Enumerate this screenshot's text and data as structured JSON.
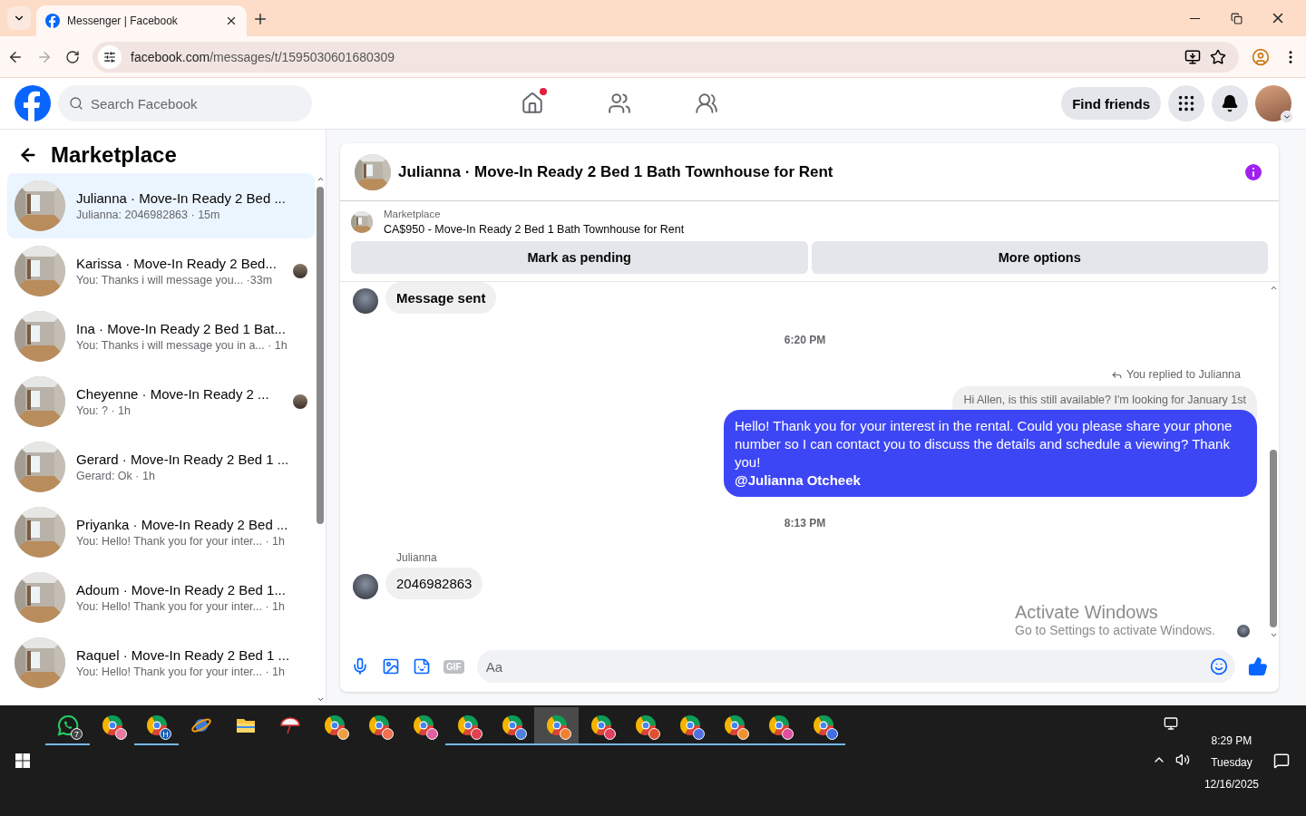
{
  "browser": {
    "tabs": [
      {
        "title": "Messenger | Facebook",
        "selected": true
      }
    ],
    "url_domain": "facebook.com",
    "url_path": "/messages/t/1595030601680309"
  },
  "header": {
    "search_placeholder": "Search Facebook",
    "home_notification": true,
    "find_friends": "Find friends"
  },
  "sidebar": {
    "title": "Marketplace",
    "conversations": [
      {
        "title": "Julianna · Move-In Ready 2 Bed ...",
        "preview": "Julianna: 2046982863 · 15m",
        "selected": true,
        "seen": false
      },
      {
        "title": "Karissa · Move-In Ready 2 Bed...",
        "preview": "You: Thanks i will message you... ·33m",
        "selected": false,
        "seen": true
      },
      {
        "title": "Ina · Move-In Ready 2 Bed 1 Bat...",
        "preview": "You: Thanks i will message you in a... · 1h",
        "selected": false,
        "seen": false
      },
      {
        "title": "Cheyenne · Move-In Ready 2 ...",
        "preview": "You: ? · 1h",
        "selected": false,
        "seen": true
      },
      {
        "title": "Gerard · Move-In Ready 2 Bed 1 ...",
        "preview": "Gerard: Ok · 1h",
        "selected": false,
        "seen": false
      },
      {
        "title": "Priyanka · Move-In Ready 2 Bed ...",
        "preview": "You: Hello! Thank you for your inter... · 1h",
        "selected": false,
        "seen": false
      },
      {
        "title": "Adoum · Move-In Ready 2 Bed 1...",
        "preview": "You: Hello! Thank you for your inter... · 1h",
        "selected": false,
        "seen": false
      },
      {
        "title": "Raquel · Move-In Ready 2 Bed 1 ...",
        "preview": "You: Hello! Thank you for your inter... · 1h",
        "selected": false,
        "seen": false
      }
    ]
  },
  "chat": {
    "title": "Julianna · Move-In Ready 2 Bed 1 Bath Townhouse for Rent",
    "listing_label": "Marketplace",
    "listing": "CA$950 - Move-In Ready 2 Bed 1 Bath Townhouse for Rent",
    "actions": [
      "Mark as pending",
      "More options"
    ],
    "messages": [
      {
        "kind": "incoming",
        "text": "Message sent",
        "bold": true
      },
      {
        "kind": "time",
        "text": "6:20 PM"
      },
      {
        "kind": "reply_note",
        "text": "You replied to Julianna"
      },
      {
        "kind": "quoted",
        "text": "Hi Allen, is this still available? I'm looking for January 1st"
      },
      {
        "kind": "outgoing",
        "text": "Hello! Thank you for your interest in the rental. Could you please share your phone number so I can contact you to discuss the details and schedule a viewing? Thank you!",
        "mention": "@Julianna Otcheek"
      },
      {
        "kind": "time",
        "text": "8:13 PM"
      },
      {
        "kind": "incoming",
        "sender": "Julianna",
        "text": "2046982863",
        "bold": false
      }
    ],
    "composer_placeholder": "Aa",
    "gif_label": "GIF"
  },
  "os_notice": {
    "title": "Activate Windows",
    "subtitle": "Go to Settings to activate Windows."
  },
  "taskbar": {
    "apps": [
      {
        "kind": "chat",
        "badge": "7",
        "open": true,
        "selected": false
      },
      {
        "kind": "browser",
        "color": "#e87aa0",
        "open": false,
        "selected": false
      },
      {
        "kind": "browser",
        "badge": "H",
        "color": "#1a5fb4",
        "open": true,
        "selected": false
      },
      {
        "kind": "orbit",
        "open": false,
        "selected": false
      },
      {
        "kind": "folder",
        "open": false,
        "selected": false
      },
      {
        "kind": "umbrella",
        "open": false,
        "selected": false
      },
      {
        "kind": "browser",
        "color": "#f0a040",
        "open": false,
        "selected": false
      },
      {
        "kind": "browser",
        "color": "#f07050",
        "open": false,
        "selected": false
      },
      {
        "kind": "browser",
        "color": "#e060a0",
        "open": false,
        "selected": false
      },
      {
        "kind": "browser",
        "color": "#e04050",
        "open": true,
        "selected": false
      },
      {
        "kind": "browser",
        "color": "#5080e0",
        "open": true,
        "selected": false
      },
      {
        "kind": "browser",
        "color": "#f08030",
        "open": true,
        "selected": true
      },
      {
        "kind": "browser",
        "color": "#e04060",
        "open": true,
        "selected": false
      },
      {
        "kind": "browser",
        "color": "#e05030",
        "open": true,
        "selected": false
      },
      {
        "kind": "browser",
        "color": "#5070e0",
        "open": true,
        "selected": false
      },
      {
        "kind": "browser",
        "color": "#f09030",
        "open": true,
        "selected": false
      },
      {
        "kind": "browser",
        "color": "#e050a0",
        "open": true,
        "selected": false
      },
      {
        "kind": "browser",
        "color": "#4070e0",
        "open": true,
        "selected": false
      }
    ],
    "time": "8:29 PM",
    "day": "Tuesday",
    "date": "12/16/2025"
  }
}
